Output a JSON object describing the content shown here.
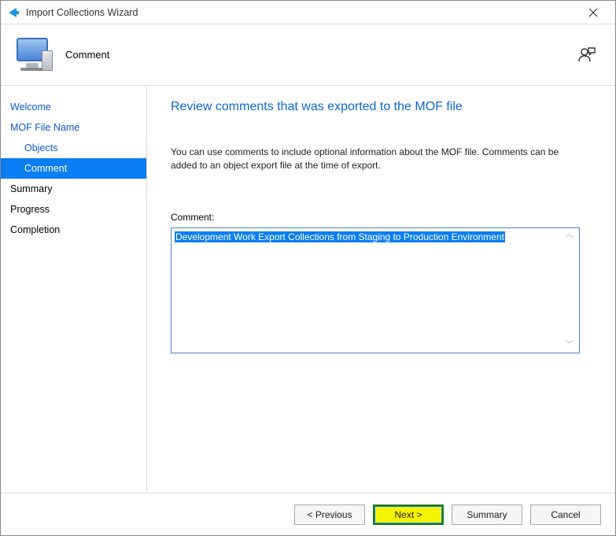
{
  "titlebar": {
    "title": "Import Collections Wizard"
  },
  "header": {
    "step_title": "Comment"
  },
  "sidebar": {
    "items": [
      {
        "label": "Welcome",
        "state": "done",
        "indent": false
      },
      {
        "label": "MOF File Name",
        "state": "done",
        "indent": false
      },
      {
        "label": "Objects",
        "state": "done",
        "indent": true
      },
      {
        "label": "Comment",
        "state": "active",
        "indent": true
      },
      {
        "label": "Summary",
        "state": "normal",
        "indent": false
      },
      {
        "label": "Progress",
        "state": "normal",
        "indent": false
      },
      {
        "label": "Completion",
        "state": "normal",
        "indent": false
      }
    ]
  },
  "main": {
    "heading": "Review comments that was exported to the MOF file",
    "description": "You can use comments to include optional information about the MOF file. Comments can be added to an object export file at the time of export.",
    "comment_label": "Comment:",
    "comment_value": "Development Work Export Collections from Staging to Production Environment"
  },
  "footer": {
    "previous": "< Previous",
    "next": "Next >",
    "summary": "Summary",
    "cancel": "Cancel"
  }
}
